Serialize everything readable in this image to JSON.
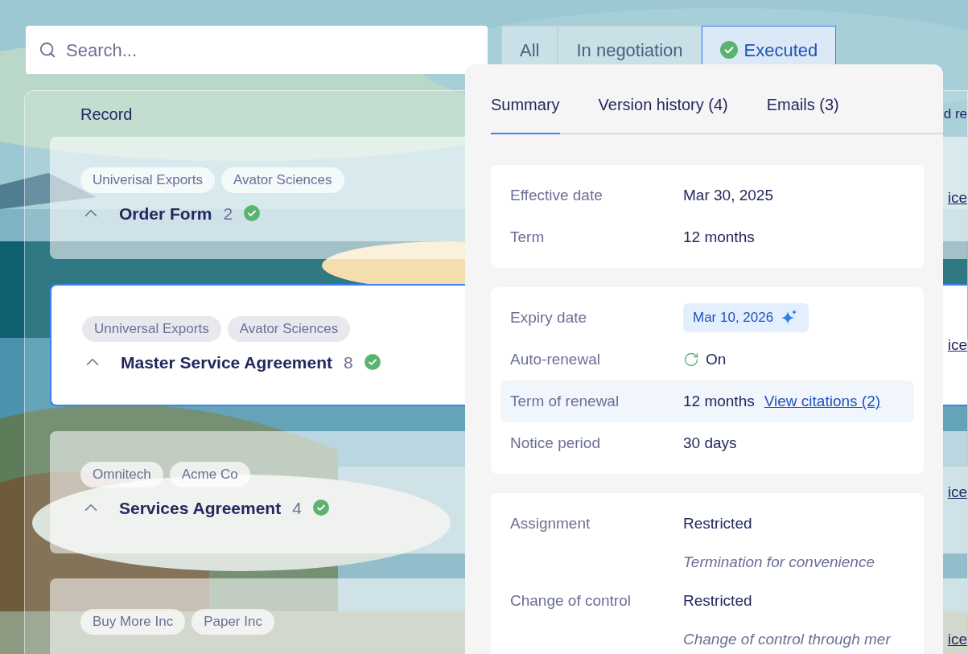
{
  "search": {
    "placeholder": "Search..."
  },
  "filters": [
    {
      "label": "All",
      "selected": false
    },
    {
      "label": "In negotiation",
      "selected": false
    },
    {
      "label": "Executed",
      "selected": true
    }
  ],
  "list": {
    "header": "Record",
    "header_right": "d re",
    "records": [
      {
        "tags": [
          "Univerisal Exports",
          "Avator Sciences"
        ],
        "title": "Order Form",
        "count": "2",
        "selected": false,
        "link": "ice"
      },
      {
        "tags": [
          "Unniversal Exports",
          "Avator Sciences"
        ],
        "title": "Master Service Agreement",
        "count": "8",
        "selected": true,
        "link": "ice"
      },
      {
        "tags": [
          "Omnitech",
          "Acme Co"
        ],
        "title": "Services Agreement",
        "count": "4",
        "selected": false,
        "link": "ice"
      },
      {
        "tags": [
          "Buy More Inc",
          "Paper Inc"
        ],
        "selected": false,
        "link": "ice"
      }
    ]
  },
  "detail": {
    "tabs": [
      {
        "label": "Summary",
        "selected": true
      },
      {
        "label": "Version history (4)",
        "selected": false
      },
      {
        "label": "Emails (3)",
        "selected": false
      }
    ],
    "sections": [
      {
        "rows": [
          {
            "kind": "text",
            "label": "Effective date",
            "value": "Mar 30, 2025"
          },
          {
            "kind": "text",
            "label": "Term",
            "value": "12 months"
          }
        ]
      },
      {
        "rows": [
          {
            "kind": "badge",
            "label": "Expiry date",
            "value": "Mar 10, 2026"
          },
          {
            "kind": "renewal",
            "label": "Auto-renewal",
            "value": "On"
          },
          {
            "kind": "citation",
            "label": "Term of renewal",
            "value": "12 months",
            "link": "View citations (2)",
            "highlighted": true
          },
          {
            "kind": "text",
            "label": "Notice period",
            "value": "30 days"
          }
        ]
      },
      {
        "rows": [
          {
            "kind": "text",
            "label": "Assignment",
            "value": "Restricted"
          },
          {
            "kind": "note",
            "value": "Termination for convenience"
          },
          {
            "kind": "text",
            "label": "Change of control",
            "value": "Restricted"
          },
          {
            "kind": "note",
            "value": "Change of control through mer"
          }
        ]
      }
    ]
  }
}
